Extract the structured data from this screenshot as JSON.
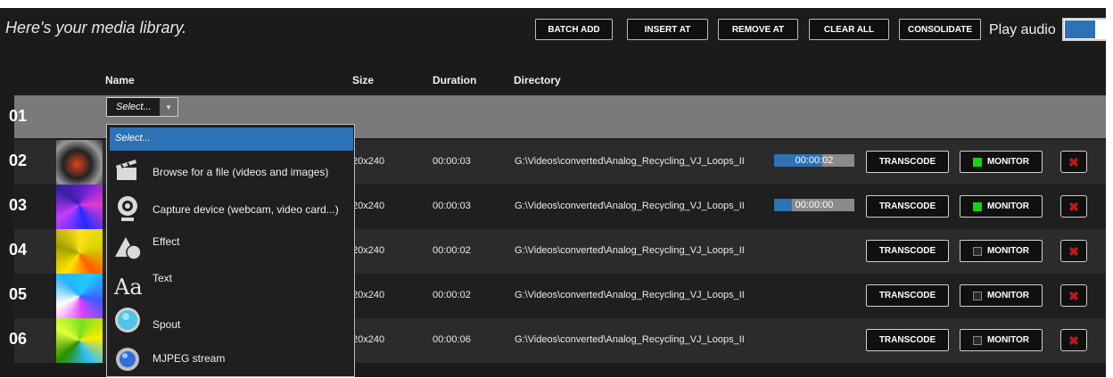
{
  "header": {
    "title": "Here's your media library.",
    "buttons": {
      "batch_add": "BATCH ADD",
      "insert_at": "INSERT AT",
      "remove_at": "REMOVE AT",
      "clear_all": "CLEAR ALL",
      "consolidate": "CONSOLIDATE"
    },
    "play_audio_label": "Play audio",
    "play_audio_enabled": true
  },
  "columns": {
    "name": "Name",
    "size": "Size",
    "duration": "Duration",
    "directory": "Directory"
  },
  "first_row": {
    "num": "01",
    "select_value": "Select..."
  },
  "rows": [
    {
      "num": "02",
      "size": "20x240",
      "duration": "00:00:03",
      "directory": "G:\\Videos\\converted\\Analog_Recycling_VJ_Loops_II",
      "progress_text": "00:00:02",
      "progress_fraction": 0.6,
      "transcode": "TRANSCODE",
      "monitor": "MONITOR",
      "monitor_on": true
    },
    {
      "num": "03",
      "size": "20x240",
      "duration": "00:00:03",
      "directory": "G:\\Videos\\converted\\Analog_Recycling_VJ_Loops_II",
      "progress_text": "00:00:00",
      "progress_fraction": 0.22,
      "transcode": "TRANSCODE",
      "monitor": "MONITOR",
      "monitor_on": true
    },
    {
      "num": "04",
      "size": "20x240",
      "duration": "00:00:02",
      "directory": "G:\\Videos\\converted\\Analog_Recycling_VJ_Loops_II",
      "transcode": "TRANSCODE",
      "monitor": "MONITOR",
      "monitor_on": false
    },
    {
      "num": "05",
      "size": "20x240",
      "duration": "00:00:02",
      "directory": "G:\\Videos\\converted\\Analog_Recycling_VJ_Loops_II",
      "transcode": "TRANSCODE",
      "monitor": "MONITOR",
      "monitor_on": false
    },
    {
      "num": "06",
      "size": "20x240",
      "duration": "00:00:06",
      "directory": "G:\\Videos\\converted\\Analog_Recycling_VJ_Loops_II",
      "transcode": "TRANSCODE",
      "monitor": "MONITOR",
      "monitor_on": false
    }
  ],
  "dropdown": {
    "selected": "Select...",
    "items": [
      {
        "label": "Browse for a file (videos and images)",
        "icon": "clapperboard-icon"
      },
      {
        "label": "Capture device (webcam, video card...)",
        "icon": "webcam-icon"
      },
      {
        "label": "Effect",
        "icon": "shapes-icon"
      },
      {
        "label": "Text",
        "icon": "text-aa-icon"
      },
      {
        "label": "Spout",
        "icon": "spout-icon"
      },
      {
        "label": "MJPEG stream",
        "icon": "stream-globe-icon"
      }
    ]
  },
  "colors": {
    "accent": "#2d72b5",
    "monitor_on": "#17d017",
    "delete": "#c01717"
  }
}
